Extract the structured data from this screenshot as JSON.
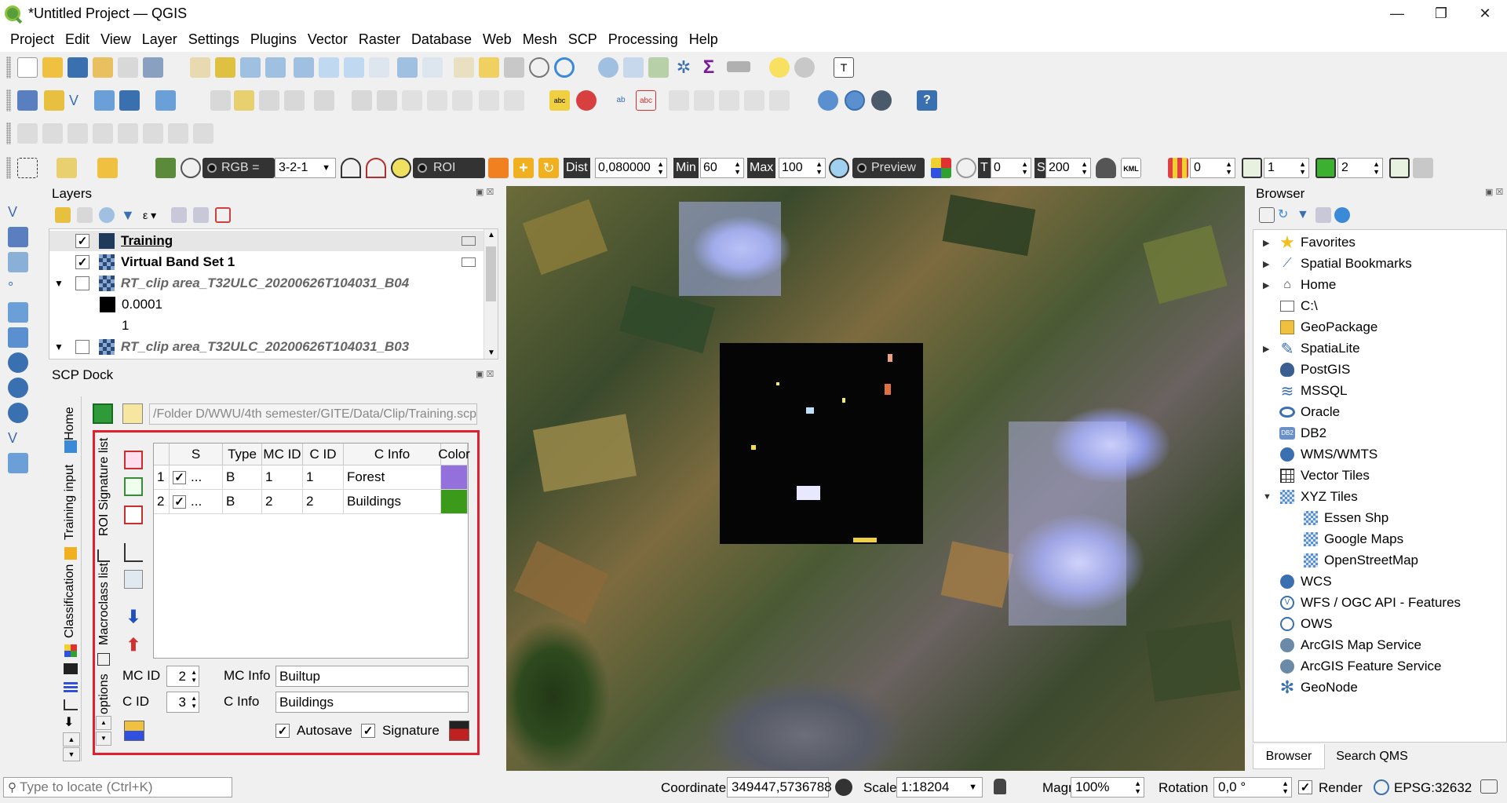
{
  "window": {
    "title": "*Untitled Project — QGIS",
    "controls": {
      "minimize": "—",
      "restore": "❐",
      "close": "✕"
    }
  },
  "menu": [
    "Project",
    "Edit",
    "View",
    "Layer",
    "Settings",
    "Plugins",
    "Vector",
    "Raster",
    "Database",
    "Web",
    "Mesh",
    "SCP",
    "Processing",
    "Help"
  ],
  "scp_toolbar": {
    "rgb_label": "RGB =",
    "rgb_value": "3-2-1",
    "roi_label": "ROI",
    "dist_label": "Dist",
    "dist_value": "0,080000",
    "min_label": "Min",
    "min_value": "60",
    "max_label": "Max",
    "max_value": "100",
    "preview_label": "Preview",
    "t_label": "T",
    "t_value": "0",
    "s_label": "S",
    "s_value": "200",
    "kml_label": "KML",
    "field1_value": "0",
    "field2_value": "1",
    "field3_value": "2"
  },
  "layers_panel": {
    "title": "Layers",
    "items": [
      {
        "name": "Training",
        "checked": true,
        "style": "bold-underline"
      },
      {
        "name": "Virtual Band Set 1",
        "checked": true,
        "style": "bold"
      },
      {
        "name": "RT_clip area_T32ULC_20200626T104031_B04",
        "checked": false,
        "style": "italic"
      },
      {
        "name": "0.0001",
        "legend": true
      },
      {
        "name": "1",
        "legend": true
      },
      {
        "name": "RT_clip area_T32ULC_20200626T104031_B03",
        "checked": false,
        "style": "italic"
      }
    ]
  },
  "scp_dock": {
    "title": "SCP Dock",
    "vertical_tabs": {
      "home": "Home",
      "training_input": "Training input",
      "classification": "Classification"
    },
    "inner_tabs": {
      "roi_signature_list": "ROI Signature list",
      "macroclass_list": "Macroclass list",
      "options": "options"
    },
    "training_file_path": "/Folder D/WWU/4th semester/GITE/Data/Clip/Training.scp",
    "table": {
      "headers": [
        "S",
        "Type",
        "MC ID",
        "C ID",
        "C Info",
        "Color"
      ],
      "rows": [
        {
          "num": "1",
          "checked": true,
          "dots": "...",
          "type": "B",
          "mc_id": "1",
          "c_id": "1",
          "c_info": "Forest",
          "color": "#9370db"
        },
        {
          "num": "2",
          "checked": true,
          "dots": "...",
          "type": "B",
          "mc_id": "2",
          "c_id": "2",
          "c_info": "Buildings",
          "color": "#3c9a1a"
        }
      ]
    },
    "mc_id_label": "MC ID",
    "mc_id_value": "2",
    "mc_info_label": "MC Info",
    "mc_info_value": "Builtup",
    "c_id_label": "C ID",
    "c_id_value": "3",
    "c_info_label": "C Info",
    "c_info_value": "Buildings",
    "autosave_label": "Autosave",
    "signature_label": "Signature"
  },
  "browser_panel": {
    "title": "Browser",
    "items": [
      {
        "label": "Favorites",
        "icon": "star-icon"
      },
      {
        "label": "Spatial Bookmarks",
        "icon": "bookmark-icon"
      },
      {
        "label": "Home",
        "icon": "home-icon"
      },
      {
        "label": "C:\\",
        "icon": "folder-icon"
      },
      {
        "label": "GeoPackage",
        "icon": "geopackage-icon"
      },
      {
        "label": "SpatiaLite",
        "icon": "spatialite-icon"
      },
      {
        "label": "PostGIS",
        "icon": "postgis-icon"
      },
      {
        "label": "MSSQL",
        "icon": "mssql-icon"
      },
      {
        "label": "Oracle",
        "icon": "oracle-icon"
      },
      {
        "label": "DB2",
        "icon": "db2-icon"
      },
      {
        "label": "WMS/WMTS",
        "icon": "wms-icon"
      },
      {
        "label": "Vector Tiles",
        "icon": "vector-tiles-icon"
      },
      {
        "label": "XYZ Tiles",
        "icon": "xyz-tiles-icon"
      },
      {
        "label": "Essen Shp",
        "icon": "xyz-tiles-icon"
      },
      {
        "label": "Google Maps",
        "icon": "xyz-tiles-icon"
      },
      {
        "label": "OpenStreetMap",
        "icon": "xyz-tiles-icon"
      },
      {
        "label": "WCS",
        "icon": "wcs-icon"
      },
      {
        "label": "WFS / OGC API - Features",
        "icon": "wfs-icon"
      },
      {
        "label": "OWS",
        "icon": "ows-icon"
      },
      {
        "label": "ArcGIS Map Service",
        "icon": "arcgis-map-icon"
      },
      {
        "label": "ArcGIS Feature Service",
        "icon": "arcgis-feature-icon"
      },
      {
        "label": "GeoNode",
        "icon": "geonode-icon"
      }
    ],
    "tabs": [
      "Browser",
      "Search QMS"
    ]
  },
  "statusbar": {
    "locator_placeholder": "Type to locate (Ctrl+K)",
    "coordinate_label": "Coordinate",
    "coordinate_value": "349447,5736788",
    "scale_label": "Scale",
    "scale_value": "1:18204",
    "magnifier_label": "Magnifier",
    "magnifier_value": "100%",
    "rotation_label": "Rotation",
    "rotation_value": "0,0 °",
    "render_label": "Render",
    "epsg_label": "EPSG:32632"
  }
}
